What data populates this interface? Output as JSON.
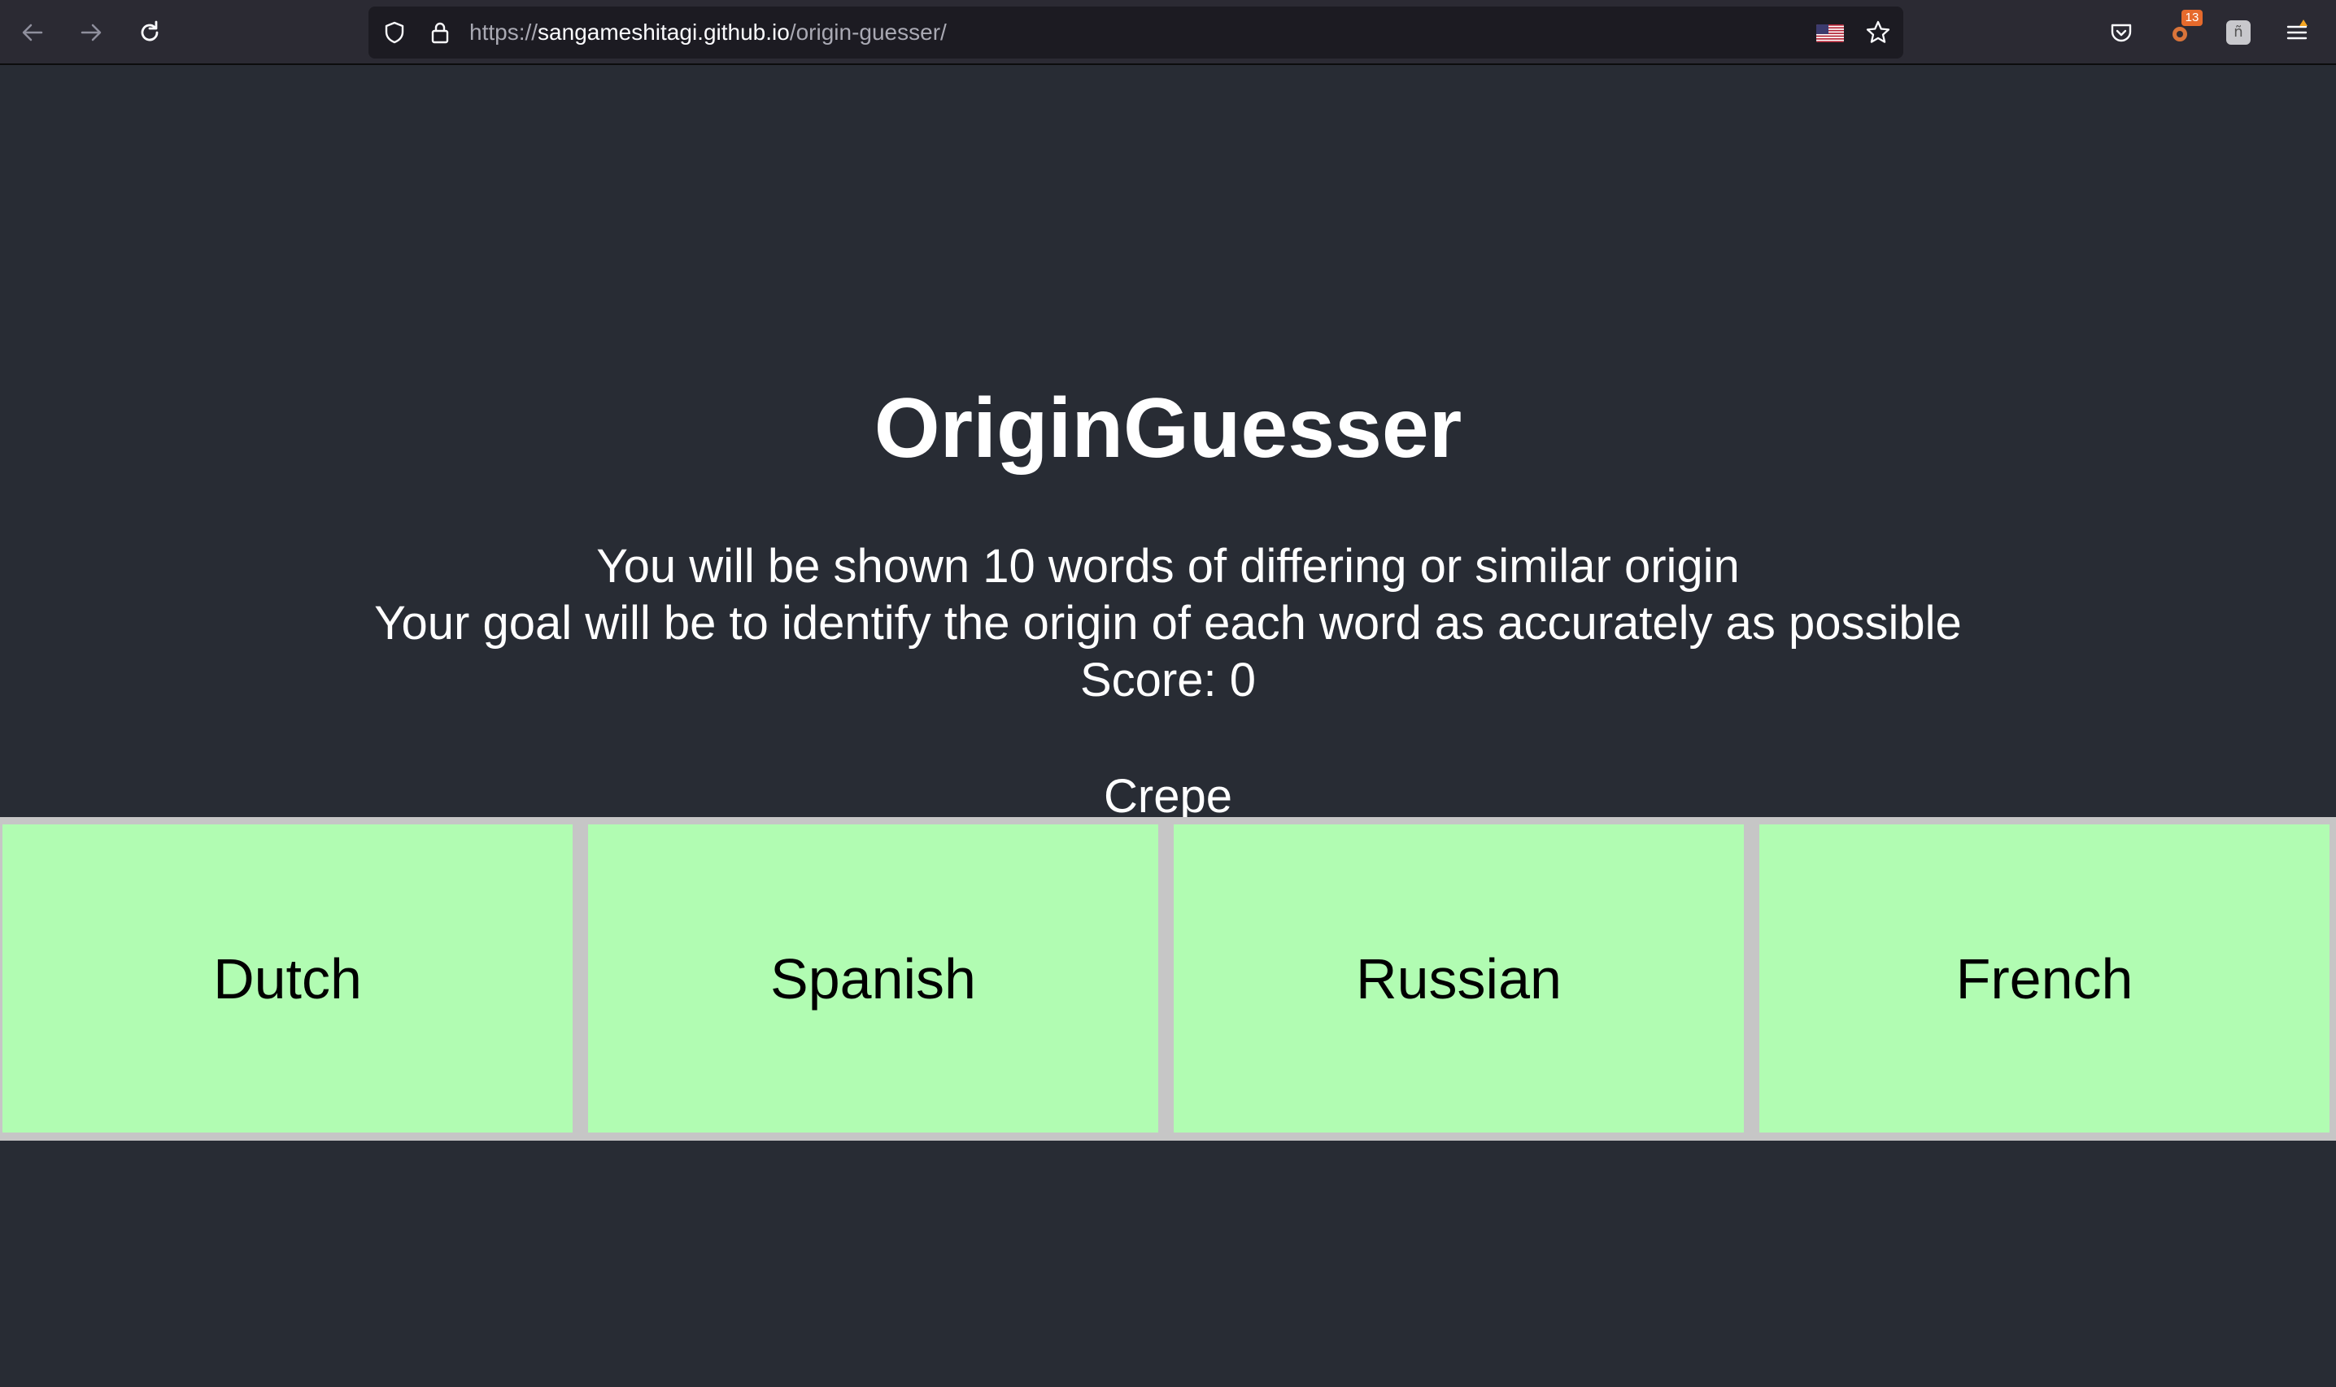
{
  "browser": {
    "url_host_prefix": "https://",
    "url_host": "sangameshitagi.github.io",
    "url_path": "/origin-guesser/",
    "extension_badge": "13",
    "extension_letter": "ñ",
    "icons": {
      "back": "arrow-left-icon",
      "forward": "arrow-right-icon",
      "reload": "reload-icon",
      "tracking": "shield-icon",
      "lock": "lock-icon",
      "flag": "us-flag-icon",
      "bookmark": "star-icon",
      "pocket": "pocket-icon",
      "menu": "hamburger-menu-icon"
    }
  },
  "app": {
    "title": "OriginGuesser",
    "description_line1": "You will be shown 10 words of differing or similar origin",
    "description_line2": "Your goal will be to identify the origin of each word as accurately as possible",
    "score_text": "Score: 0",
    "current_word": "Crepe",
    "choices": [
      {
        "label": "Dutch"
      },
      {
        "label": "Spanish"
      },
      {
        "label": "Russian"
      },
      {
        "label": "French"
      }
    ]
  },
  "colors": {
    "page_background": "#282c34",
    "choice_background": "#b1fcb2",
    "choice_border": "#c6c6c6",
    "toolbar_background": "#2b2a33"
  }
}
